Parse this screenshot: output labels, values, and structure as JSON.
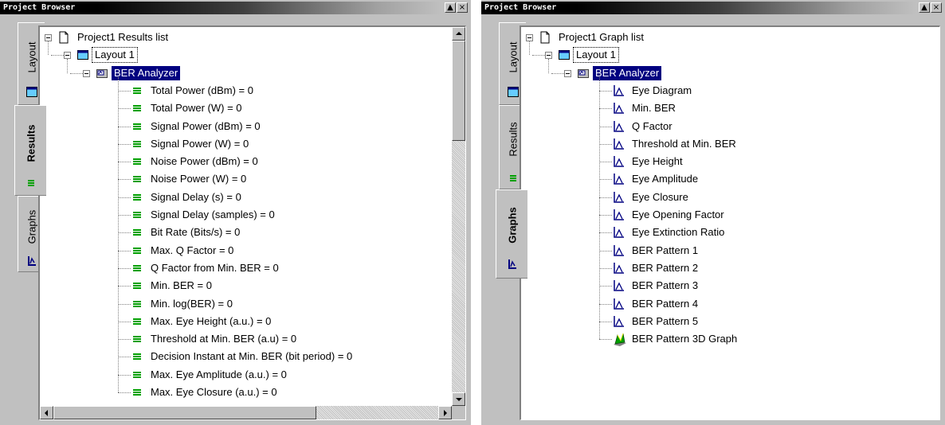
{
  "left_panel": {
    "title": "Project Browser",
    "tabs": [
      {
        "label": "Layout",
        "icon": "layout-icon",
        "active": false
      },
      {
        "label": "Results",
        "icon": "results-icon",
        "active": true
      },
      {
        "label": "Graphs",
        "icon": "graphs-icon",
        "active": false
      }
    ],
    "tree": {
      "root": "Project1 Results list",
      "layout": "Layout 1",
      "component": "BER Analyzer",
      "items": [
        "Total Power (dBm) = 0",
        "Total Power (W) = 0",
        "Signal Power (dBm) = 0",
        "Signal Power (W) = 0",
        "Noise Power (dBm) = 0",
        "Noise Power (W) = 0",
        "Signal Delay (s) = 0",
        "Signal Delay (samples) = 0",
        "Bit Rate (Bits/s) = 0",
        "Max. Q Factor = 0",
        "Q Factor from Min. BER = 0",
        "Min. BER = 0",
        "Min. log(BER) = 0",
        "Max. Eye Height (a.u.) = 0",
        "Threshold at Min. BER (a.u) = 0",
        "Decision Instant at Min. BER (bit period) = 0",
        "Max. Eye Amplitude (a.u.) = 0",
        "Max. Eye Closure (a.u.) = 0"
      ]
    }
  },
  "right_panel": {
    "title": "Project Browser",
    "tabs": [
      {
        "label": "Layout",
        "icon": "layout-icon",
        "active": false
      },
      {
        "label": "Results",
        "icon": "results-icon",
        "active": false
      },
      {
        "label": "Graphs",
        "icon": "graphs-icon",
        "active": true
      }
    ],
    "tree": {
      "root": "Project1 Graph list",
      "layout": "Layout 1",
      "component": "BER Analyzer",
      "items": [
        "Eye Diagram",
        "Min. BER",
        "Q Factor",
        "Threshold at Min. BER",
        "Eye Height",
        "Eye Amplitude",
        "Eye Closure",
        "Eye Opening Factor",
        "Eye Extinction Ratio",
        "BER Pattern 1",
        "BER Pattern 2",
        "BER Pattern 3",
        "BER Pattern 4",
        "BER Pattern 5",
        "BER Pattern 3D Graph"
      ]
    }
  },
  "colors": {
    "selection": "#000080",
    "results_icon": "#00a000",
    "graph_icon": "#000080",
    "window_face": "#c0c0c0"
  }
}
